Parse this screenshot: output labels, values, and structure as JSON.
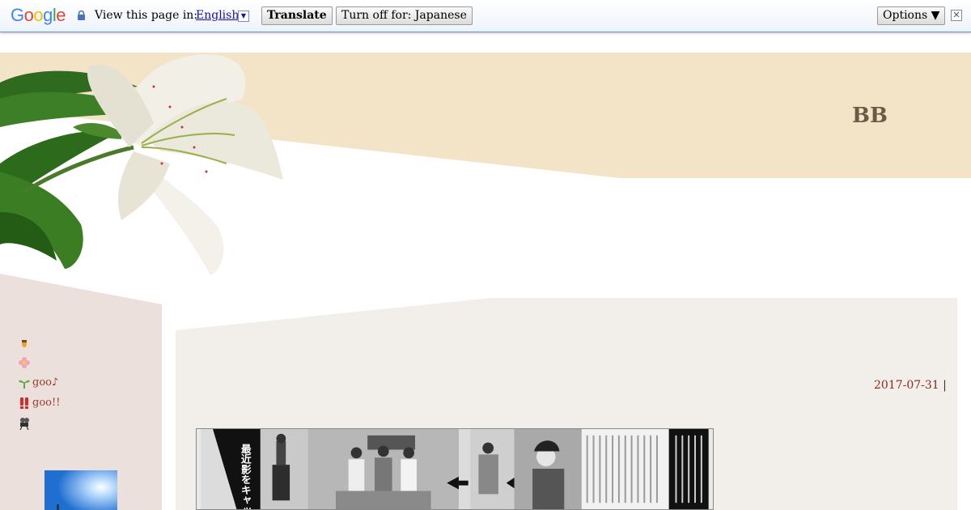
{
  "translate_bar": {
    "logo_letters": [
      "G",
      "o",
      "o",
      "g",
      "l",
      "e"
    ],
    "logo_colors": [
      "#4285f4",
      "#ea4335",
      "#fbbc05",
      "#4285f4",
      "#34a853",
      "#ea4335"
    ],
    "prompt_label": "View this page in:",
    "language": "English",
    "dropdown_glyph": "▼",
    "translate_label": "Translate",
    "turn_off_label": "Turn off for: Japanese",
    "options_label": "Options ▼",
    "close_glyph": "✕",
    "icons": {
      "lock": "lock-icon"
    }
  },
  "header": {
    "title": "BB",
    "band_color": "#f3e4c7"
  },
  "sidebar": {
    "background": "#ece0dc",
    "items": [
      {
        "icon": "acorn-icon",
        "label": ""
      },
      {
        "icon": "flower-icon",
        "label": ""
      },
      {
        "icon": "sprout-icon",
        "label": "goo♪"
      },
      {
        "icon": "exclamation-icon",
        "label": "goo!!"
      },
      {
        "icon": "camera-icon",
        "label": ""
      }
    ],
    "link_color": "#9a3a2c"
  },
  "post": {
    "date": "2017-07-31",
    "separator": "|",
    "image_caption_vertical": "最近影をキャッチ",
    "date_color": "#8b2a1e"
  },
  "colors": {
    "content_bg": "#f2eeea",
    "accent_blue": "#6b90c8"
  }
}
